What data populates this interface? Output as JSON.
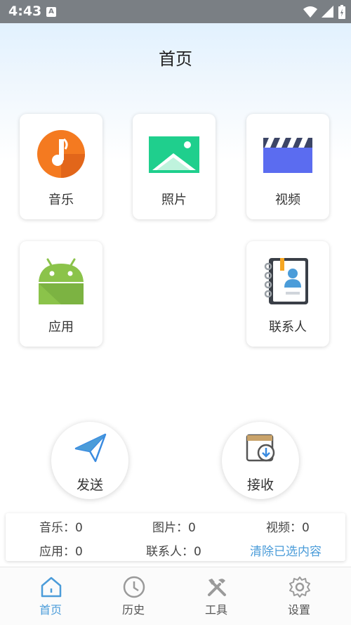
{
  "status_bar": {
    "time": "4:43",
    "sim_label": "A"
  },
  "header": {
    "title": "首页"
  },
  "categories": [
    {
      "label": "音乐",
      "icon": "music-icon"
    },
    {
      "label": "照片",
      "icon": "photo-icon"
    },
    {
      "label": "视频",
      "icon": "video-icon"
    },
    {
      "label": "应用",
      "icon": "android-app-icon"
    },
    {
      "label": "联系人",
      "icon": "contacts-icon"
    }
  ],
  "actions": {
    "send_label": "发送",
    "receive_label": "接收"
  },
  "stats": {
    "music": "音乐：0",
    "pictures": "图片：0",
    "videos": "视频：0",
    "apps": "应用：0",
    "contacts": "联系人：0",
    "clear": "清除已选内容"
  },
  "tabs": [
    {
      "label": "首页",
      "icon": "home-icon",
      "active": true
    },
    {
      "label": "历史",
      "icon": "clock-icon",
      "active": false
    },
    {
      "label": "工具",
      "icon": "tools-icon",
      "active": false
    },
    {
      "label": "设置",
      "icon": "settings-gear-icon",
      "active": false
    }
  ],
  "colors": {
    "accent": "#4b9cd9",
    "music": "#f47a20",
    "photo": "#1fcf8d",
    "video": "#5b6cf0",
    "android": "#8bc34a"
  }
}
